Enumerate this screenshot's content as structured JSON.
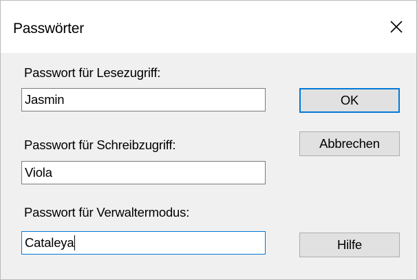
{
  "window": {
    "title": "Passwörter",
    "close_icon": "close-icon"
  },
  "fields": {
    "read": {
      "label": "Passwort für Lesezugriff:",
      "value": "Jasmin"
    },
    "write": {
      "label": "Passwort für Schreibzugriff:",
      "value": "Viola"
    },
    "admin": {
      "label": "Passwort für Verwaltermodus:",
      "value": "Cataleya"
    }
  },
  "buttons": {
    "ok": "OK",
    "cancel": "Abbrechen",
    "help": "Hilfe"
  },
  "colors": {
    "focus_accent": "#0078d7",
    "dialog_background": "#f0f0f0",
    "button_face": "#e1e1e1"
  }
}
